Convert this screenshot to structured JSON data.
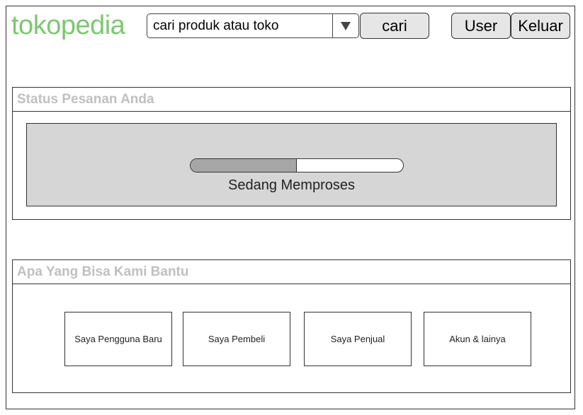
{
  "header": {
    "logo_text": "tokopedia",
    "search": {
      "value": "cari produk atau toko"
    },
    "search_button": "cari",
    "user_button": "User",
    "logout_button": "Keluar"
  },
  "status_panel": {
    "title": "Status Pesanan Anda",
    "progress_fraction": 0.5,
    "status_text": "Sedang Memproses"
  },
  "help_panel": {
    "title": "Apa Yang Bisa Kami Bantu",
    "options": [
      "Saya Pengguna Baru",
      "Saya Pembeli",
      "Saya Penjual",
      "Akun & lainya"
    ]
  }
}
